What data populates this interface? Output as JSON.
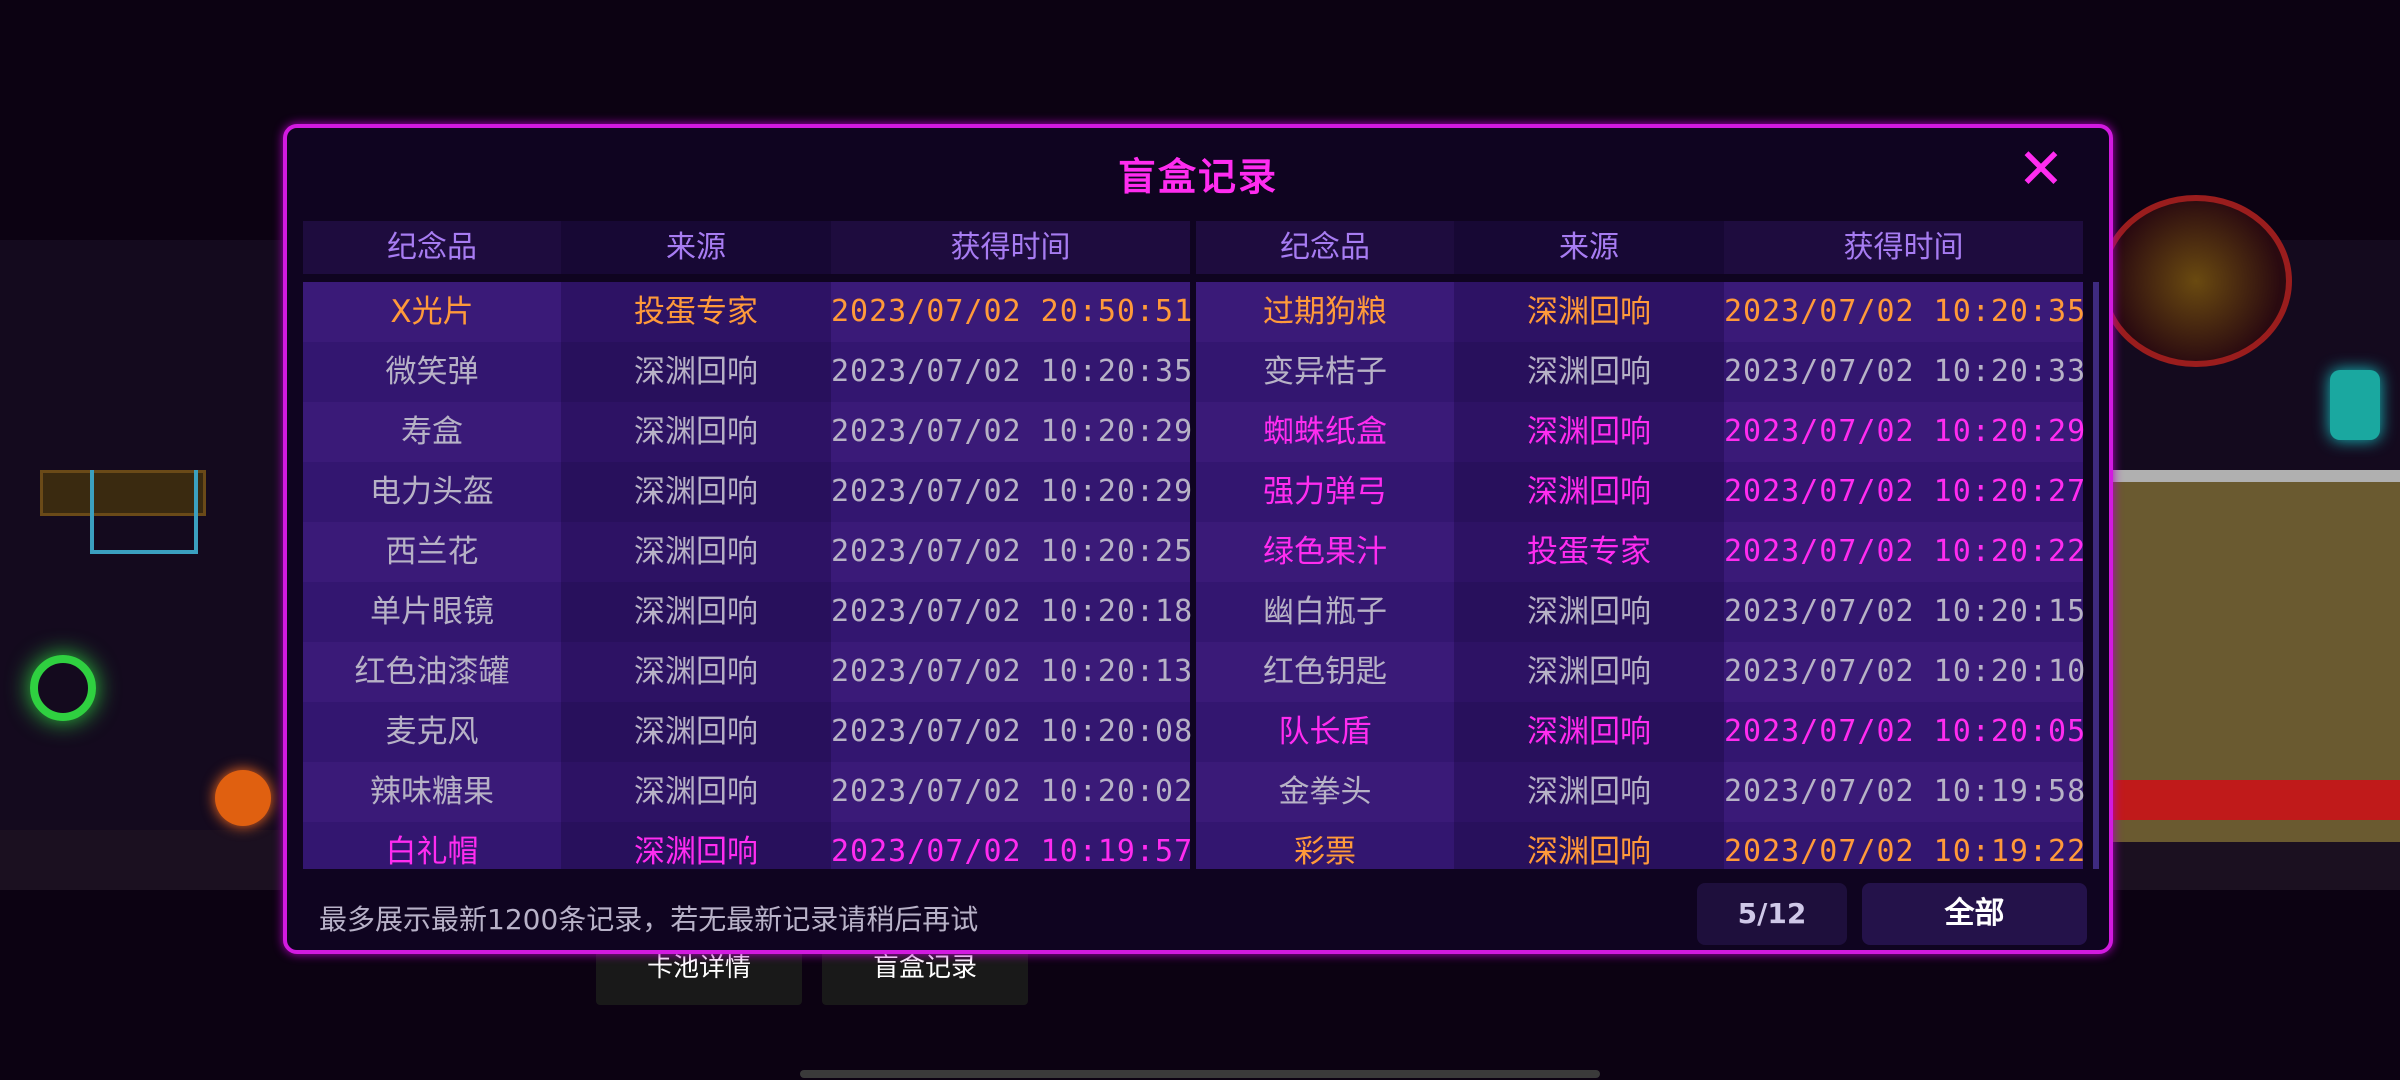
{
  "dialog": {
    "title": "盲盒记录",
    "close_icon": "close-icon",
    "headers": [
      "纪念品",
      "来源",
      "获得时间"
    ],
    "footer_note": "最多展示最新1200条记录，若无最新记录请稍后再试",
    "page_indicator": "5/12",
    "all_button": "全部"
  },
  "colors": {
    "orange": "#ff9a3a",
    "gray": "#b7b2c6",
    "pink": "#ff2cf0",
    "accent": "#d21ae0"
  },
  "left_rows": [
    {
      "item": "X光片",
      "source": "投蛋专家",
      "time": "2023/07/02 20:50:51",
      "color": "orange"
    },
    {
      "item": "微笑弹",
      "source": "深渊回响",
      "time": "2023/07/02 10:20:35",
      "color": "gray"
    },
    {
      "item": "寿盒",
      "source": "深渊回响",
      "time": "2023/07/02 10:20:29",
      "color": "gray"
    },
    {
      "item": "电力头盔",
      "source": "深渊回响",
      "time": "2023/07/02 10:20:29",
      "color": "gray"
    },
    {
      "item": "西兰花",
      "source": "深渊回响",
      "time": "2023/07/02 10:20:25",
      "color": "gray"
    },
    {
      "item": "单片眼镜",
      "source": "深渊回响",
      "time": "2023/07/02 10:20:18",
      "color": "gray"
    },
    {
      "item": "红色油漆罐",
      "source": "深渊回响",
      "time": "2023/07/02 10:20:13",
      "color": "gray"
    },
    {
      "item": "麦克风",
      "source": "深渊回响",
      "time": "2023/07/02 10:20:08",
      "color": "gray"
    },
    {
      "item": "辣味糖果",
      "source": "深渊回响",
      "time": "2023/07/02 10:20:02",
      "color": "gray"
    },
    {
      "item": "白礼帽",
      "source": "深渊回响",
      "time": "2023/07/02 10:19:57",
      "color": "pink"
    }
  ],
  "right_rows": [
    {
      "item": "过期狗粮",
      "source": "深渊回响",
      "time": "2023/07/02 10:20:35",
      "color": "orange"
    },
    {
      "item": "变异桔子",
      "source": "深渊回响",
      "time": "2023/07/02 10:20:33",
      "color": "gray"
    },
    {
      "item": "蜘蛛纸盒",
      "source": "深渊回响",
      "time": "2023/07/02 10:20:29",
      "color": "pink"
    },
    {
      "item": "强力弹弓",
      "source": "深渊回响",
      "time": "2023/07/02 10:20:27",
      "color": "pink"
    },
    {
      "item": "绿色果汁",
      "source": "投蛋专家",
      "time": "2023/07/02 10:20:22",
      "color": "pink"
    },
    {
      "item": "幽白瓶子",
      "source": "深渊回响",
      "time": "2023/07/02 10:20:15",
      "color": "gray"
    },
    {
      "item": "红色钥匙",
      "source": "深渊回响",
      "time": "2023/07/02 10:20:10",
      "color": "gray"
    },
    {
      "item": "队长盾",
      "source": "深渊回响",
      "time": "2023/07/02 10:20:05",
      "color": "pink"
    },
    {
      "item": "金拳头",
      "source": "深渊回响",
      "time": "2023/07/02 10:19:58",
      "color": "gray"
    },
    {
      "item": "彩票",
      "source": "深渊回响",
      "time": "2023/07/02 10:19:22",
      "color": "orange"
    }
  ],
  "bottom_tabs": [
    "卡池详情",
    "盲盒记录"
  ]
}
